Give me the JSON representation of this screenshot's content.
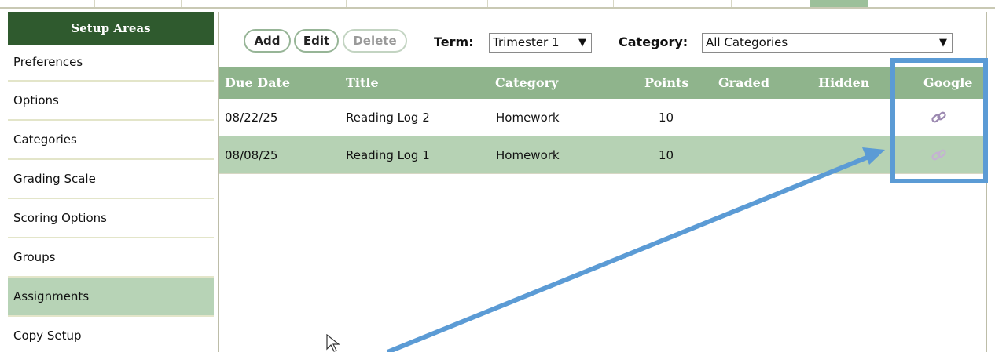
{
  "sidebar": {
    "header": "Setup Areas",
    "items": [
      {
        "label": "Preferences"
      },
      {
        "label": "Options"
      },
      {
        "label": "Categories"
      },
      {
        "label": "Grading Scale"
      },
      {
        "label": "Scoring Options"
      },
      {
        "label": "Groups"
      },
      {
        "label": "Assignments",
        "active": true
      },
      {
        "label": "Copy Setup"
      }
    ]
  },
  "toolbar": {
    "add_label": "Add",
    "edit_label": "Edit",
    "delete_label": "Delete",
    "term_label": "Term:",
    "term_value": "Trimester 1",
    "category_label": "Category:",
    "category_value": "All Categories"
  },
  "table": {
    "columns": [
      "Due Date",
      "Title",
      "Category",
      "Points",
      "Graded",
      "Hidden",
      "Google"
    ],
    "rows": [
      {
        "due_date": "08/22/25",
        "title": "Reading Log 2",
        "category": "Homework",
        "points": "10",
        "graded": "",
        "hidden": "",
        "google_icon": "link-icon"
      },
      {
        "due_date": "08/08/25",
        "title": "Reading Log 1",
        "category": "Homework",
        "points": "10",
        "graded": "",
        "hidden": "",
        "google_icon": "link-icon"
      }
    ]
  },
  "colors": {
    "sidebar_header": "#2f5a2e",
    "table_header": "#8fb48c",
    "selected_row": "#b6d2b4",
    "annotation": "#5b9bd5"
  }
}
